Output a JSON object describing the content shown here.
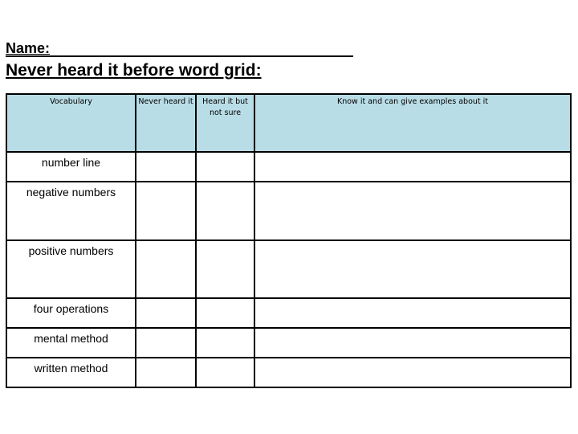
{
  "header": {
    "name_label": "Name:",
    "title": "Never heard it before word grid:"
  },
  "table": {
    "header_color": "#b9dde6",
    "columns": [
      "Vocabulary",
      "Never heard it",
      "Heard it but not sure",
      "Know it and can give examples about it"
    ],
    "rows": [
      {
        "word": "number line",
        "never_heard": "",
        "heard_not_sure": "",
        "know_it": ""
      },
      {
        "word": "negative numbers",
        "never_heard": "",
        "heard_not_sure": "",
        "know_it": ""
      },
      {
        "word": "positive numbers",
        "never_heard": "",
        "heard_not_sure": "",
        "know_it": ""
      },
      {
        "word": "four operations",
        "never_heard": "",
        "heard_not_sure": "",
        "know_it": ""
      },
      {
        "word": "mental method",
        "never_heard": "",
        "heard_not_sure": "",
        "know_it": ""
      },
      {
        "word": "written method",
        "never_heard": "",
        "heard_not_sure": "",
        "know_it": ""
      }
    ]
  }
}
